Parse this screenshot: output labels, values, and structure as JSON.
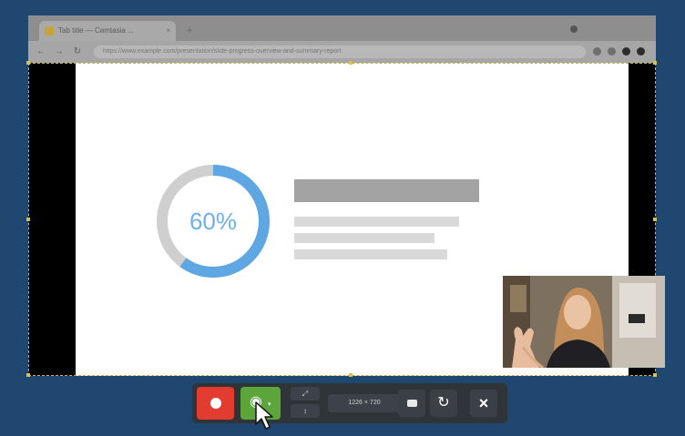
{
  "browser": {
    "tab_title": "Tab title — Camtasia ...",
    "tab_close": "×",
    "new_tab": "+",
    "address": "https://www.example.com/presentation/slide-progress-overview-and-summary-report",
    "nav": {
      "back": "←",
      "forward": "→",
      "reload": "↻"
    }
  },
  "slide": {
    "progress_label": "60%",
    "progress_fraction": 0.6
  },
  "recorder": {
    "width_label": "⤢",
    "height_label": "↕",
    "dimensions": "1226 × 720",
    "reset_symbol": "↻",
    "close_symbol": "×",
    "webcam_glyph": "◉"
  },
  "colors": {
    "record": "#e23b2f",
    "webcam_on": "#5ba53a",
    "desktop": "#1f4770",
    "progress_arc": "#5ea7e3",
    "progress_track": "#cfcfcf"
  },
  "icons": [
    "record-icon",
    "webcam-icon",
    "resize-icon",
    "snapshot-icon",
    "reset-icon",
    "close-icon"
  ]
}
